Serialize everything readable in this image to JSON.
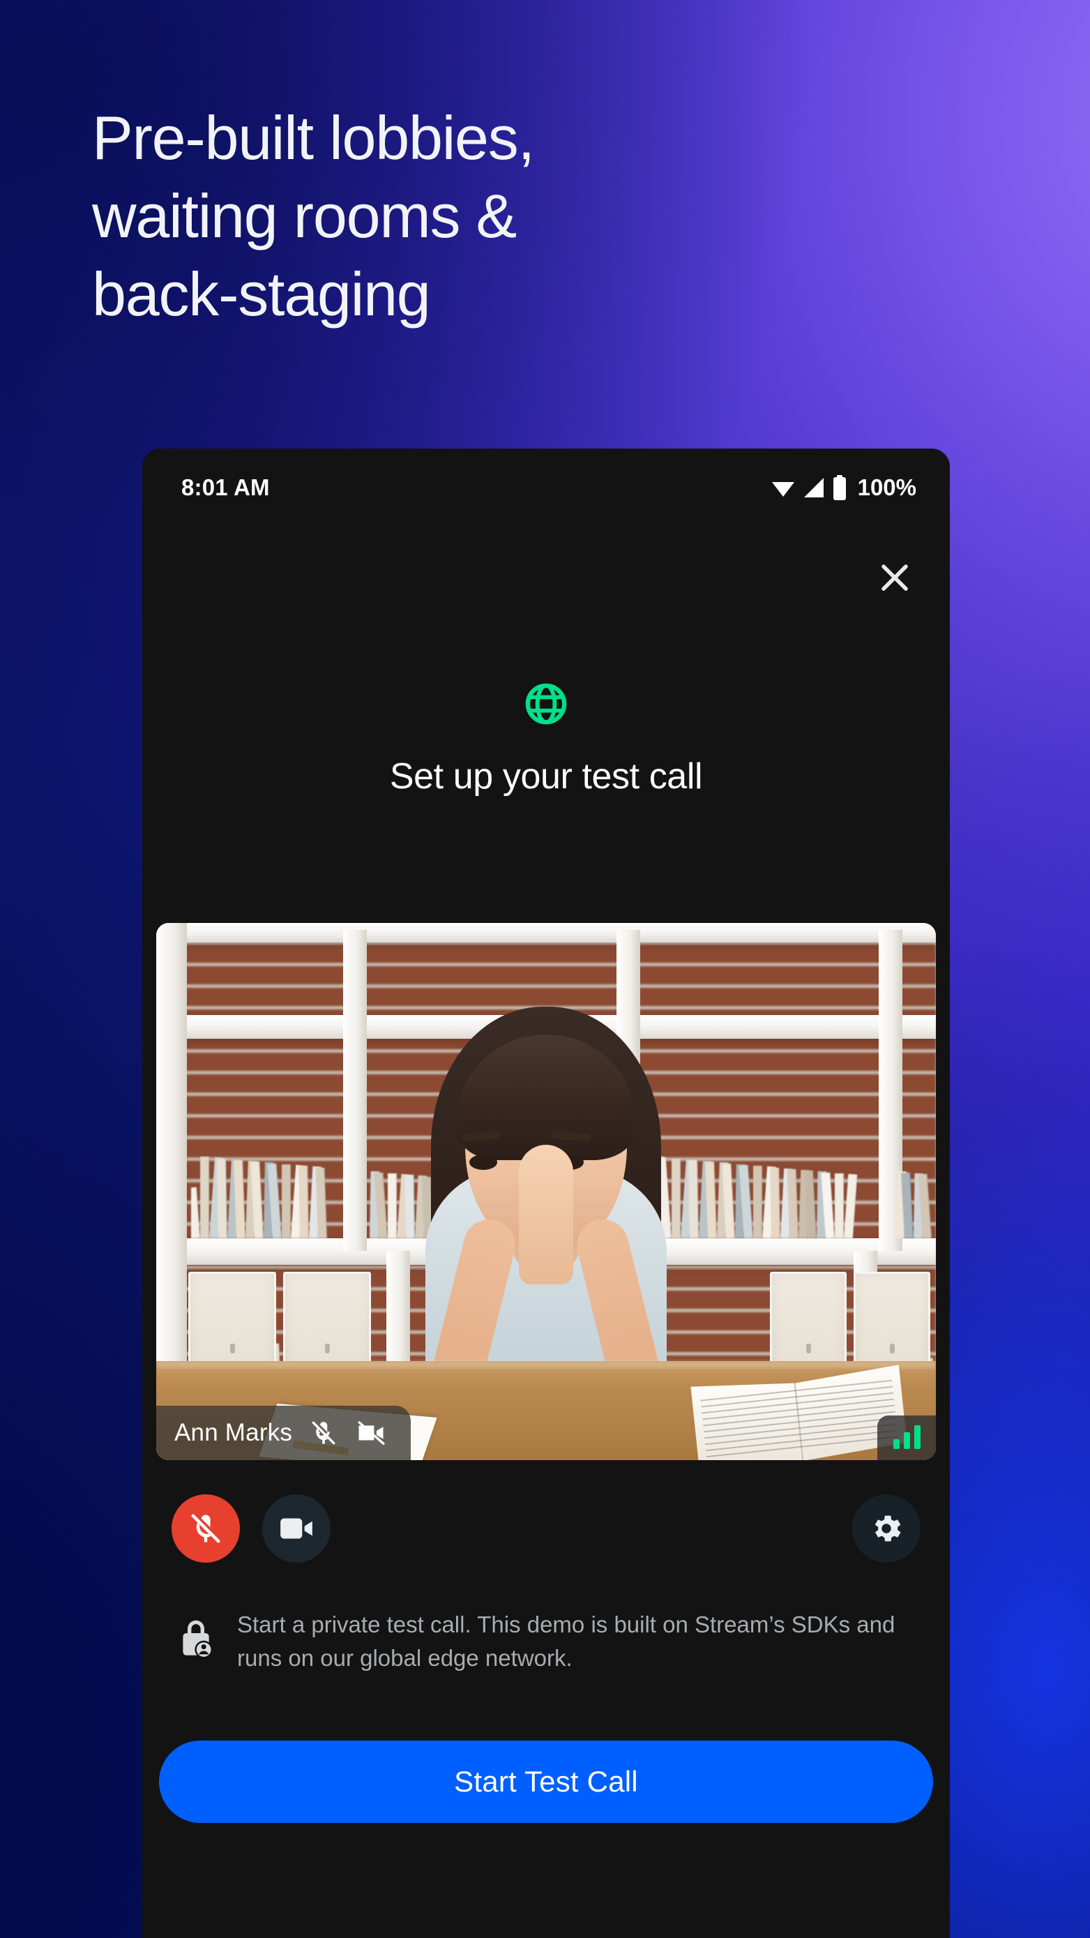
{
  "promo": {
    "headline": "Pre-built lobbies,\nwaiting rooms &\nback-staging"
  },
  "phone": {
    "status_bar": {
      "time": "8:01 AM",
      "wifi_icon": "wifi-icon",
      "cellular_icon": "cellular-signal-icon",
      "battery_icon": "battery-full-icon",
      "battery_percent": "100%"
    },
    "screen": {
      "close_icon": "close-icon",
      "globe_icon": "globe-icon",
      "title": "Set up your test call",
      "video": {
        "participant_name": "Ann Marks",
        "mic_icon": "mic-off-icon",
        "camera_icon": "video-off-icon",
        "signal_icon": "signal-strength-icon"
      },
      "controls": {
        "mic": {
          "icon": "mic-off-icon",
          "label": "Microphone off"
        },
        "camera": {
          "icon": "video-camera-icon",
          "label": "Camera"
        },
        "settings": {
          "icon": "gear-icon",
          "label": "Settings"
        }
      },
      "footer": {
        "lock_icon": "lock-person-icon",
        "text": "Start a private test call. This demo is built on Stream’s SDKs and runs on our global edge network."
      },
      "cta_label": "Start Test Call"
    }
  },
  "colors": {
    "accent_green": "#00E08A",
    "cta_blue": "#005FFF",
    "mic_red": "#E8402F",
    "phone_bg": "#131314"
  }
}
